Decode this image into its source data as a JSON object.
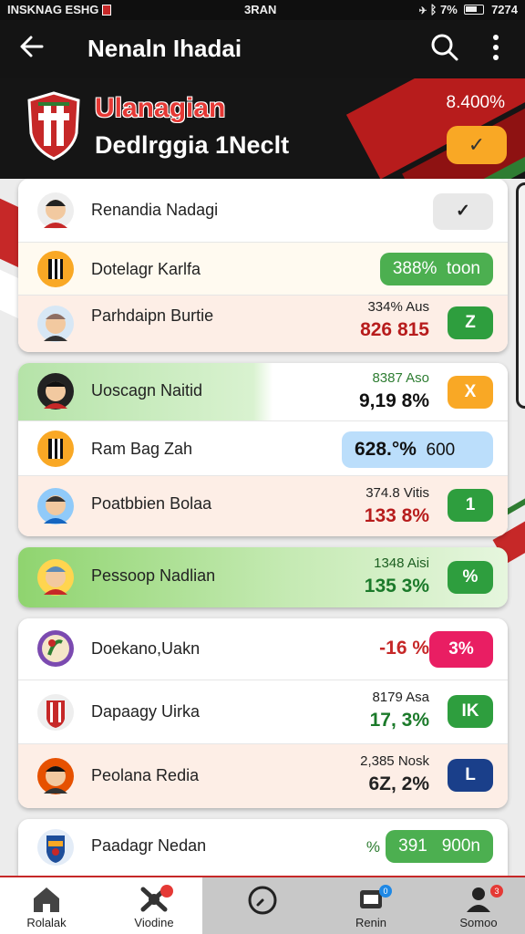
{
  "status_bar": {
    "left": "INSKNAG ESHG",
    "center": "3RAN",
    "right": "7%",
    "time": "7274"
  },
  "app_bar": {
    "title": "Nenaln Ihadai"
  },
  "hero": {
    "club_name": "Ulanagian",
    "subtitle": "Dedlrggia 1Neclt",
    "percent": "8.400%",
    "button": "✓"
  },
  "group1": {
    "header": {
      "name": "Renandia Nadagi",
      "badge": "✓"
    },
    "rows": [
      {
        "name": "Dotelagr Karlfa",
        "pill_value": "388%",
        "pill_suffix": "toon"
      },
      {
        "name": "Parhdaipn Burtie",
        "v1": "334% Aus",
        "v2": "826 815",
        "badge": "Z"
      }
    ]
  },
  "group2": {
    "rows": [
      {
        "name": "Uoscagn Naitid",
        "v1": "8387 Aso",
        "v2": "9,19 8%",
        "badge": "X"
      },
      {
        "name": "Ram Bag Zah",
        "pill_value": "628.°%",
        "pill_suffix": "600"
      },
      {
        "name": "Poatbbien Bolaa",
        "v1": "374.8 Vitis",
        "v2": "133 8%",
        "badge": "1"
      }
    ]
  },
  "group3": {
    "rows": [
      {
        "name": "Pessoop Nadlian",
        "v1": "1348 Aisi",
        "v2": "135 3%",
        "badge": "%"
      }
    ]
  },
  "group4": {
    "rows": [
      {
        "name": "Doekano,Uakn",
        "v2": "-16 %",
        "badge": "3%"
      },
      {
        "name": "Dapaagy Uirka",
        "v1": "8179 Asa",
        "v2": "17, 3%",
        "badge": "IK"
      },
      {
        "name": "Peolana Redia",
        "v1": "2,385 Nosk",
        "v2": "6Z, 2%",
        "badge": "L"
      }
    ]
  },
  "group5": {
    "rows": [
      {
        "name": "Paadagr Nedan",
        "pill_prefix": "%",
        "pill_value": "391",
        "pill_suffix": "900n"
      }
    ]
  },
  "bottom_nav": {
    "items": [
      {
        "label": "Rolalak"
      },
      {
        "label": "Viodine"
      },
      {
        "label": ""
      },
      {
        "label": "Renin",
        "badge": "0"
      },
      {
        "label": "Somoo",
        "badge": "3"
      }
    ]
  },
  "colors": {
    "accent_red": "#c62828",
    "green": "#2e9e3e",
    "orange": "#f9a825",
    "pink": "#e91e63",
    "navy": "#1a3f8a"
  }
}
